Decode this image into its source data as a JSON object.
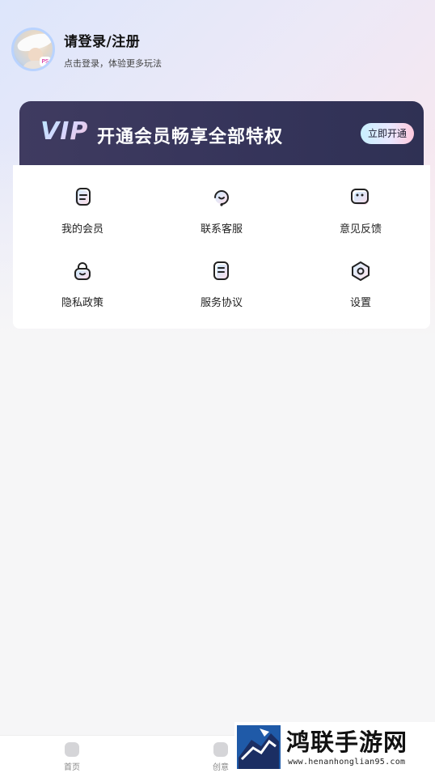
{
  "profile": {
    "login_title": "请登录/注册",
    "login_subtitle": "点击登录，体验更多玩法",
    "avatar_badge": "PS"
  },
  "vip_banner": {
    "logo": "VIP",
    "text": "开通会员畅享全部特权",
    "button": "立即开通"
  },
  "menu": {
    "items": [
      {
        "label": "我的会员",
        "icon": "member-card-icon"
      },
      {
        "label": "联系客服",
        "icon": "customer-service-icon"
      },
      {
        "label": "意见反馈",
        "icon": "feedback-icon"
      },
      {
        "label": "隐私政策",
        "icon": "lock-icon"
      },
      {
        "label": "服务协议",
        "icon": "document-icon"
      },
      {
        "label": "设置",
        "icon": "settings-icon"
      }
    ]
  },
  "bottom_nav": {
    "items": [
      {
        "label": "首页",
        "icon": "home-icon"
      },
      {
        "label": "创意",
        "icon": "create-icon"
      }
    ]
  },
  "watermark": {
    "title": "鸿联手游网",
    "url": "www.henanhonglian95.com"
  },
  "colors": {
    "vip_bg": "#35345a",
    "accent_blue": "#b9e7ff",
    "accent_pink": "#ffc9dd",
    "page_bg": "#f6f6f7"
  }
}
